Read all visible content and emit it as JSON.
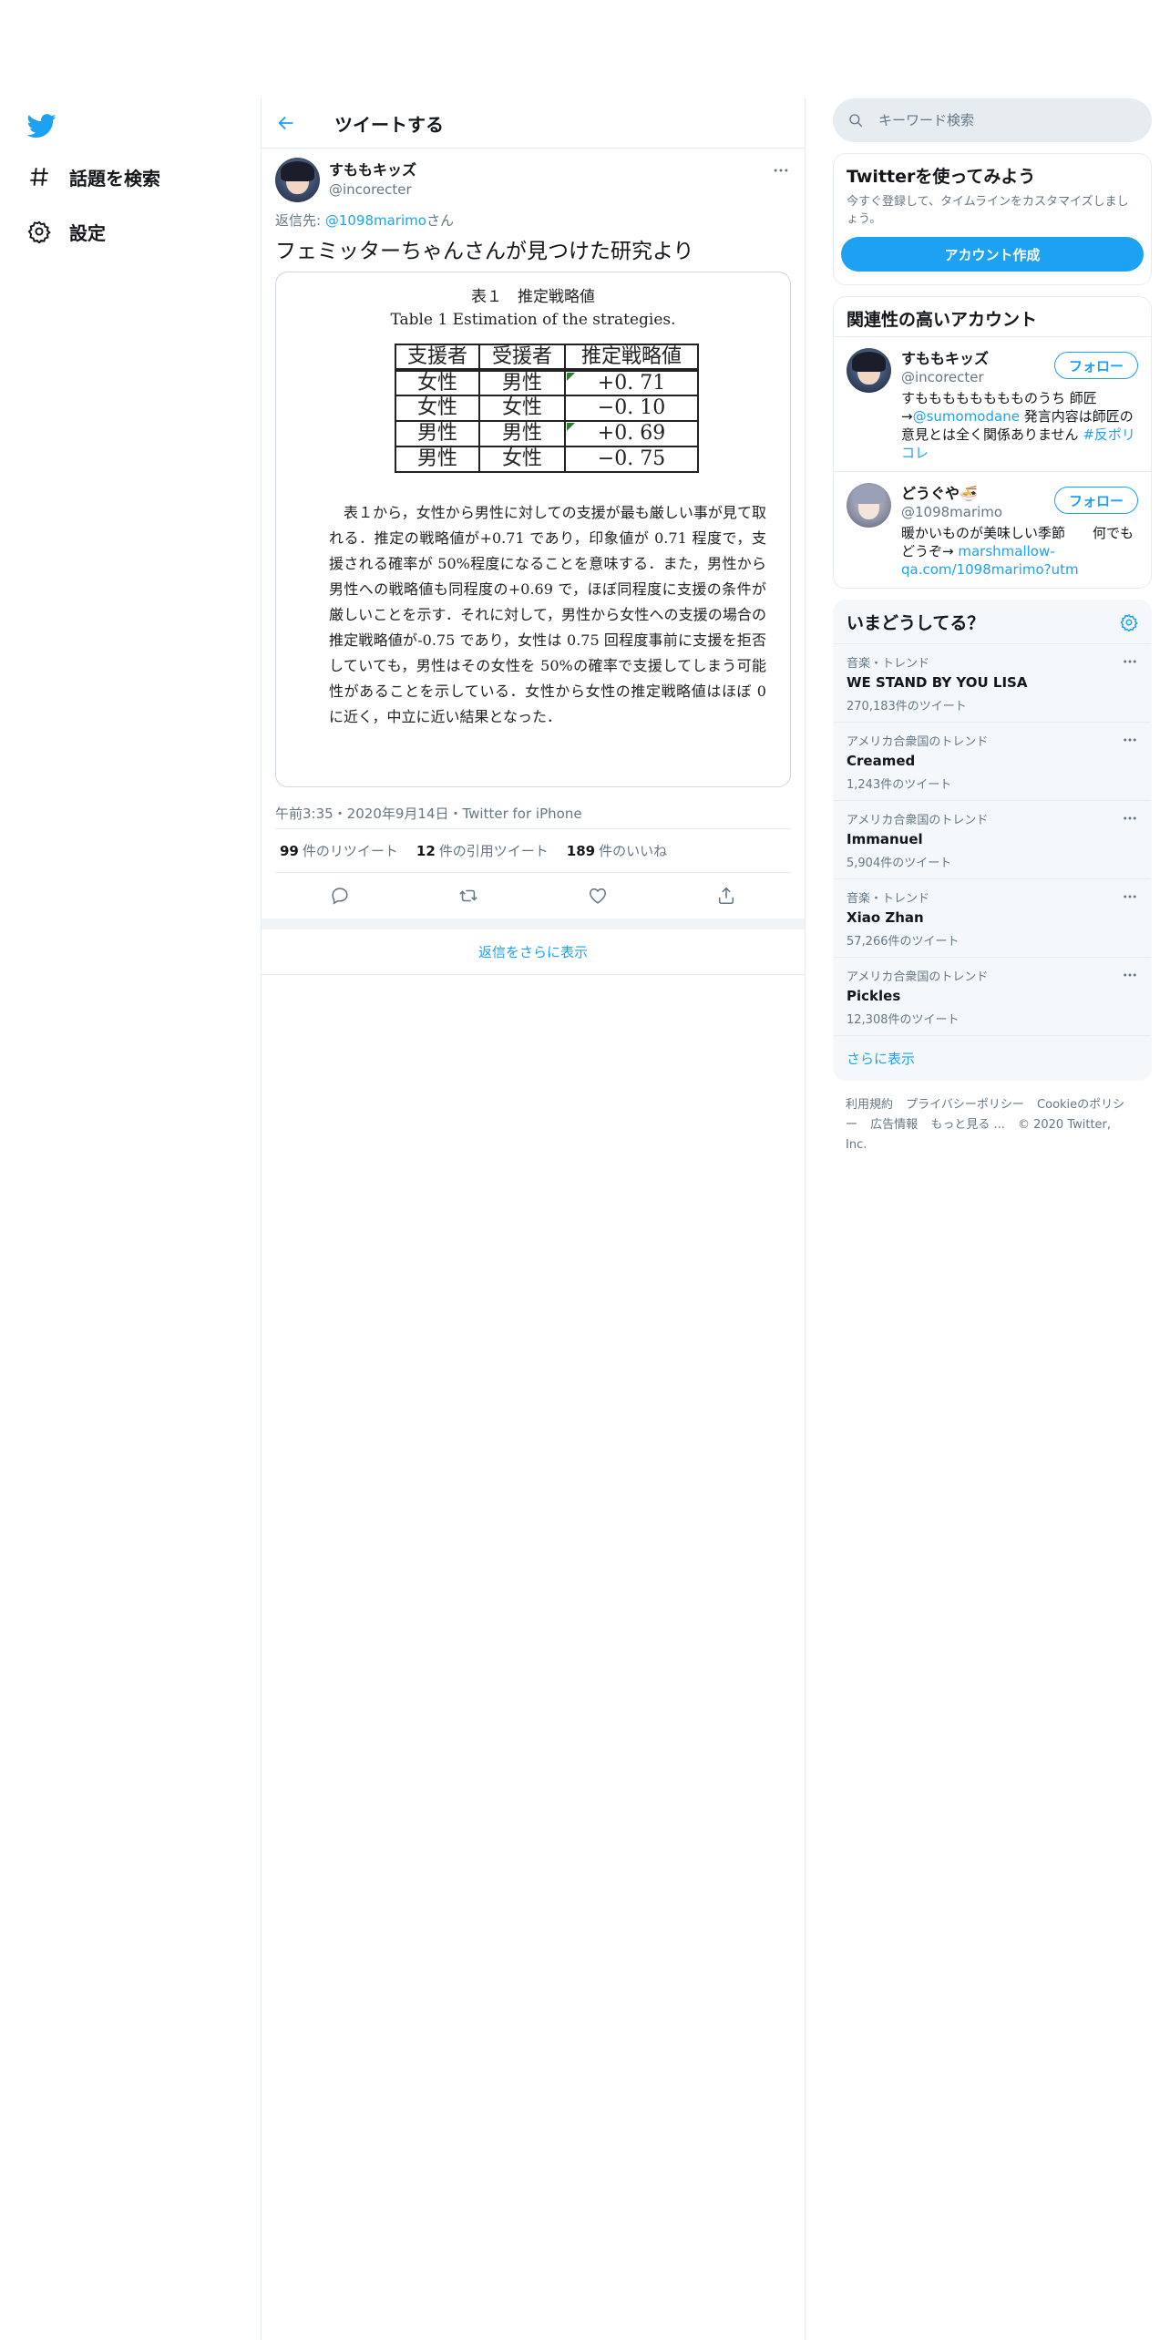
{
  "nav": {
    "explore": "話題を検索",
    "settings": "設定"
  },
  "header": {
    "title": "ツイートする"
  },
  "tweet": {
    "display_name": "すももキッズ",
    "handle": "@incorecter",
    "reply_prefix": "返信先: ",
    "reply_to": "@1098marimo",
    "reply_suffix": "さん",
    "text": "フェミッターちゃんさんが見つけた研究より",
    "image": {
      "title_ja": "表１　推定戦略値",
      "title_en": "Table 1 Estimation of the strategies.",
      "table": {
        "header": [
          "支援者",
          "受援者",
          "推定戦略値"
        ],
        "rows": [
          [
            "女性",
            "男性",
            "+0. 71"
          ],
          [
            "女性",
            "女性",
            "−0. 10"
          ],
          [
            "男性",
            "男性",
            "+0. 69"
          ],
          [
            "男性",
            "女性",
            "−0. 75"
          ]
        ]
      },
      "paragraph": "　表１から，女性から男性に対しての支援が最も厳しい事が見て取れる．推定の戦略値が+0.71 であり，印象値が 0.71 程度で，支援される確率が 50%程度になることを意味する．また，男性から男性への戦略値も同程度の+0.69 で，ほぼ同程度に支援の条件が厳しいことを示す．それに対して，男性から女性への支援の場合の推定戦略値が-0.75 であり，女性は 0.75 回程度事前に支援を拒否していても，男性はその女性を 50%の確率で支援してしまう可能性があることを示している．女性から女性の推定戦略値はほぼ 0 に近く，中立に近い結果となった．"
    },
    "meta": "午前3:35・2020年9月14日・Twitter for iPhone",
    "retweets": "99",
    "retweets_label": "件のリツイート",
    "quotes": "12",
    "quotes_label": "件の引用ツイート",
    "likes": "189",
    "likes_label": "件のいいね",
    "show_more_replies": "返信をさらに表示"
  },
  "search": {
    "placeholder": "キーワード検索"
  },
  "signup": {
    "title": "Twitterを使ってみよう",
    "desc": "今すぐ登録して、タイムラインをカスタマイズしましょう。",
    "button": "アカウント作成"
  },
  "wtf": {
    "title": "関連性の高いアカウント",
    "follow_label": "フォロー",
    "accounts": [
      {
        "name": "すももキッズ",
        "handle": "@incorecter",
        "bio_pre": "すもももももももものうち 師匠→",
        "bio_link": "@sumomodane",
        "bio_mid": " 発言内容は師匠の意見とは全く関係ありません ",
        "bio_tag": "#反ポリコレ"
      },
      {
        "name": "どうぐや🍜",
        "handle": "@1098marimo",
        "bio_pre": "暖かいものが美味しい季節　　何でもどうぞ→ ",
        "bio_link": "marshmallow-qa.com/1098marimo?utm"
      }
    ]
  },
  "trends": {
    "title": "いまどうしてる？",
    "items": [
      {
        "context": "音楽・トレンド",
        "name": "WE STAND BY YOU LISA",
        "count": "270,183件のツイート"
      },
      {
        "context": "アメリカ合衆国のトレンド",
        "name": "Creamed",
        "count": "1,243件のツイート"
      },
      {
        "context": "アメリカ合衆国のトレンド",
        "name": "Immanuel",
        "count": "5,904件のツイート"
      },
      {
        "context": "音楽・トレンド",
        "name": "Xiao Zhan",
        "count": "57,266件のツイート"
      },
      {
        "context": "アメリカ合衆国のトレンド",
        "name": "Pickles",
        "count": "12,308件のツイート"
      }
    ],
    "show_more": "さらに表示"
  },
  "footer": {
    "terms": "利用規約",
    "privacy": "プライバシーポリシー",
    "cookies": "Cookieのポリシー",
    "ads": "広告情報",
    "more": "もっと見る ...",
    "copyright": "© 2020 Twitter, Inc."
  },
  "colors": {
    "accent": "#1da1f2",
    "text": "#14171a",
    "secondary": "#657786",
    "border": "#e6ecf0"
  }
}
